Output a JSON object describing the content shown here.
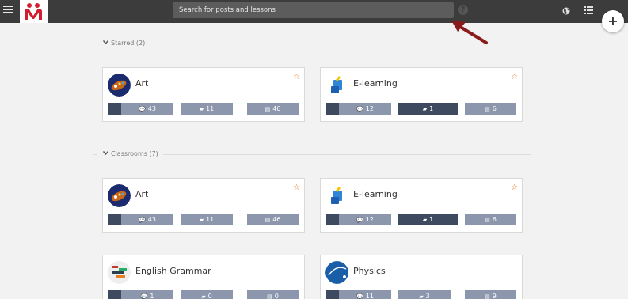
{
  "search": {
    "placeholder": "Search for posts and lessons"
  },
  "icons": {
    "menu": "hamburger-icon",
    "logo": "app-logo",
    "help": "help-icon",
    "globe": "globe-icon",
    "list": "list-icon",
    "add": "plus-icon"
  },
  "help_label": "?",
  "fab_label": "+",
  "sections": {
    "starred": {
      "label": "Starred (2)"
    },
    "classrooms": {
      "label": "Classrooms (7)"
    }
  },
  "cards": {
    "starred_art": {
      "title": "Art",
      "star": "☆",
      "stats": [
        "43",
        "11",
        "46"
      ]
    },
    "starred_elearning": {
      "title": "E-learning",
      "star": "☆",
      "stats": [
        "12",
        "1",
        "6"
      ]
    },
    "class_art": {
      "title": "Art",
      "star": "☆",
      "stats": [
        "43",
        "11",
        "46"
      ]
    },
    "class_elearning": {
      "title": "E-learning",
      "star": "☆",
      "stats": [
        "12",
        "1",
        "6"
      ]
    },
    "class_grammar": {
      "title": "English Grammar",
      "stats": [
        "1",
        "0",
        "0"
      ]
    },
    "class_physics": {
      "title": "Physics",
      "stats": [
        "11",
        "3",
        "9"
      ]
    }
  },
  "colors": {
    "topbar": "#3c3c3c",
    "stat": "#8c96ad",
    "stat_active": "#3d4a60",
    "star": "#e8701a",
    "arrow": "#8b1a1a"
  }
}
